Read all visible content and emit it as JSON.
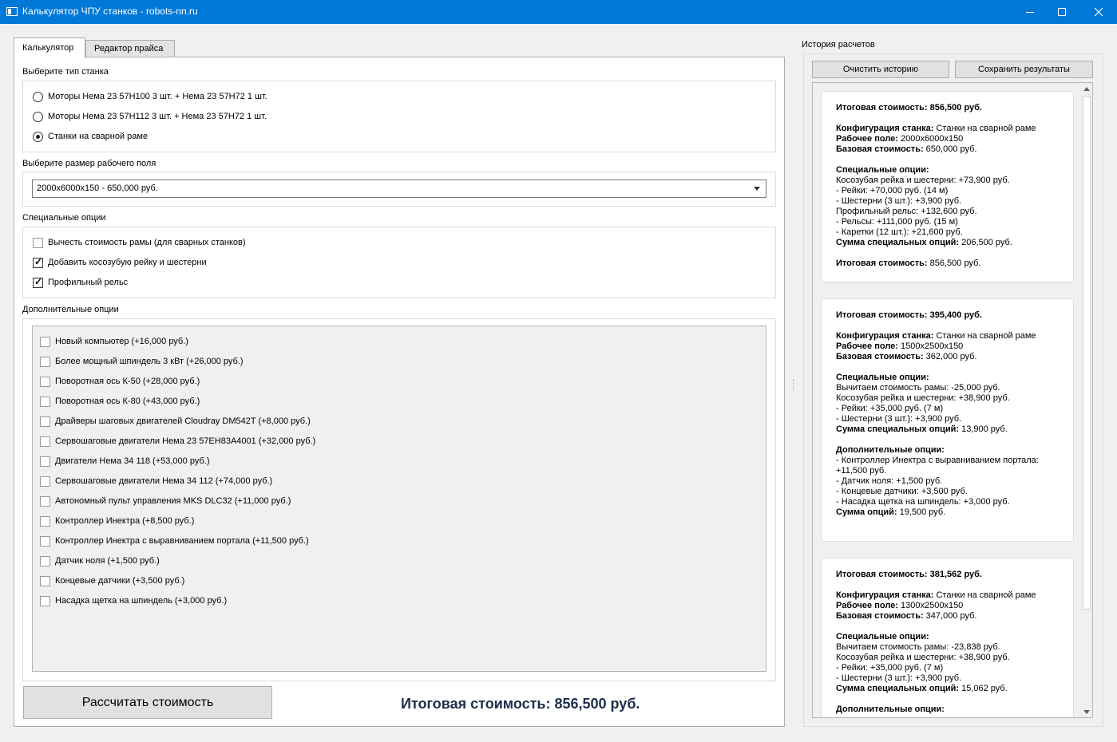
{
  "window": {
    "title": "Калькулятор ЧПУ станков - robots-nn.ru"
  },
  "tabs": [
    {
      "label": "Калькулятор",
      "active": true
    },
    {
      "label": "Редактор прайса",
      "active": false
    }
  ],
  "machine_type": {
    "label": "Выберите тип станка",
    "options": [
      {
        "label": "Моторы Нема 23 57H100 3 шт. + Нема 23 57H72 1 шт.",
        "selected": false
      },
      {
        "label": "Моторы Нема 23 57H112 3 шт. + Нема 23 57H72 1 шт.",
        "selected": false
      },
      {
        "label": "Станки на сварной раме",
        "selected": true
      }
    ]
  },
  "work_area": {
    "label": "Выберите размер рабочего поля",
    "selected": "2000x6000x150 - 650,000 руб."
  },
  "special_options": {
    "label": "Специальные опции",
    "items": [
      {
        "label": "Вычесть стоимость рамы (для сварных станков)",
        "checked": false
      },
      {
        "label": "Добавить косозубую рейку и шестерни",
        "checked": true
      },
      {
        "label": "Профильный рельс",
        "checked": true
      }
    ]
  },
  "extra_options": {
    "label": "Дополнительные опции",
    "items": [
      {
        "label": "Новый компьютер (+16,000 руб.)",
        "checked": false
      },
      {
        "label": "Более мощный шпиндель 3 кВт (+26,000 руб.)",
        "checked": false
      },
      {
        "label": "Поворотная ось К-50 (+28,000 руб.)",
        "checked": false
      },
      {
        "label": "Поворотная ось К-80 (+43,000 руб.)",
        "checked": false
      },
      {
        "label": "Драйверы шаговых двигателей Cloudray DM542T (+8,000 руб.)",
        "checked": false
      },
      {
        "label": "Сервошаговые двигатели Нема 23 57EH83A4001 (+32,000 руб.)",
        "checked": false
      },
      {
        "label": "Двигатели Нема 34 118 (+53,000 руб.)",
        "checked": false
      },
      {
        "label": "Сервошаговые двигатели Нема 34 112 (+74,000 руб.)",
        "checked": false
      },
      {
        "label": "Автономный пульт управления MKS DLC32 (+11,000 руб.)",
        "checked": false
      },
      {
        "label": "Контроллер Инектра (+8,500 руб.)",
        "checked": false
      },
      {
        "label": "Контроллер Инектра с выравниванием портала (+11,500 руб.)",
        "checked": false
      },
      {
        "label": "Датчик ноля (+1,500 руб.)",
        "checked": false
      },
      {
        "label": "Концевые датчики (+3,500 руб.)",
        "checked": false
      },
      {
        "label": "Насадка щетка на шпиндель (+3,000 руб.)",
        "checked": false
      }
    ]
  },
  "calculate_button": "Рассчитать стоимость",
  "total": "Итоговая стоимость: 856,500 руб.",
  "history": {
    "title": "История расчетов",
    "clear_button": "Очистить историю",
    "save_button": "Сохранить результаты",
    "entries": [
      {
        "lines": [
          {
            "b": "Итоговая стоимость: 856,500 руб.",
            "t": ""
          },
          {
            "gap": true
          },
          {
            "b": "Конфигурация станка:",
            "t": " Станки на сварной раме"
          },
          {
            "b": "Рабочее поле:",
            "t": " 2000x6000x150"
          },
          {
            "b": "Базовая стоимость:",
            "t": " 650,000 руб."
          },
          {
            "gap": true
          },
          {
            "b": "Специальные опции:",
            "t": ""
          },
          {
            "b": "",
            "t": "Косозубая рейка и шестерни: +73,900 руб."
          },
          {
            "b": "",
            "t": "- Рейки: +70,000 руб. (14 м)"
          },
          {
            "b": "",
            "t": "- Шестерни (3 шт.): +3,900 руб."
          },
          {
            "b": "",
            "t": "Профильный рельс: +132,600 руб."
          },
          {
            "b": "",
            "t": "- Рельсы: +111,000 руб. (15 м)"
          },
          {
            "b": "",
            "t": "- Каретки (12 шт.): +21,600 руб."
          },
          {
            "b": "Сумма специальных опций:",
            "t": " 206,500 руб."
          },
          {
            "gap": true
          },
          {
            "b": "Итоговая стоимость:",
            "t": " 856,500 руб."
          }
        ]
      },
      {
        "lines": [
          {
            "b": "Итоговая стоимость: 395,400 руб.",
            "t": ""
          },
          {
            "gap": true
          },
          {
            "b": "Конфигурация станка:",
            "t": " Станки на сварной раме"
          },
          {
            "b": "Рабочее поле:",
            "t": " 1500x2500x150"
          },
          {
            "b": "Базовая стоимость:",
            "t": " 362,000 руб."
          },
          {
            "gap": true
          },
          {
            "b": "Специальные опции:",
            "t": ""
          },
          {
            "b": "",
            "t": "Вычитаем стоимость рамы: -25,000 руб."
          },
          {
            "b": "",
            "t": "Косозубая рейка и шестерни: +38,900 руб."
          },
          {
            "b": "",
            "t": "- Рейки: +35,000 руб. (7 м)"
          },
          {
            "b": "",
            "t": "- Шестерни (3 шт.): +3,900 руб."
          },
          {
            "b": "Сумма специальных опций:",
            "t": " 13,900 руб."
          },
          {
            "gap": true
          },
          {
            "b": "Дополнительные опции:",
            "t": ""
          },
          {
            "b": "",
            "t": "- Контроллер Инектра с выравниванием портала:"
          },
          {
            "b": "",
            "t": "+11,500 руб."
          },
          {
            "b": "",
            "t": "- Датчик ноля: +1,500 руб."
          },
          {
            "b": "",
            "t": "- Концевые датчики: +3,500 руб."
          },
          {
            "b": "",
            "t": "- Насадка щетка на шпиндель: +3,000 руб."
          },
          {
            "b": "Сумма опций:",
            "t": " 19,500 руб."
          }
        ]
      },
      {
        "lines": [
          {
            "b": "Итоговая стоимость: 381,562 руб.",
            "t": ""
          },
          {
            "gap": true
          },
          {
            "b": "Конфигурация станка:",
            "t": " Станки на сварной раме"
          },
          {
            "b": "Рабочее поле:",
            "t": " 1300x2500x150"
          },
          {
            "b": "Базовая стоимость:",
            "t": " 347,000 руб."
          },
          {
            "gap": true
          },
          {
            "b": "Специальные опции:",
            "t": ""
          },
          {
            "b": "",
            "t": "Вычитаем стоимость рамы: -23,838 руб."
          },
          {
            "b": "",
            "t": "Косозубая рейка и шестерни: +38,900 руб."
          },
          {
            "b": "",
            "t": "- Рейки: +35,000 руб. (7 м)"
          },
          {
            "b": "",
            "t": "- Шестерни (3 шт.): +3,900 руб."
          },
          {
            "b": "Сумма специальных опций:",
            "t": " 15,062 руб."
          },
          {
            "gap": true
          },
          {
            "b": "Дополнительные опции:",
            "t": ""
          }
        ]
      }
    ]
  }
}
